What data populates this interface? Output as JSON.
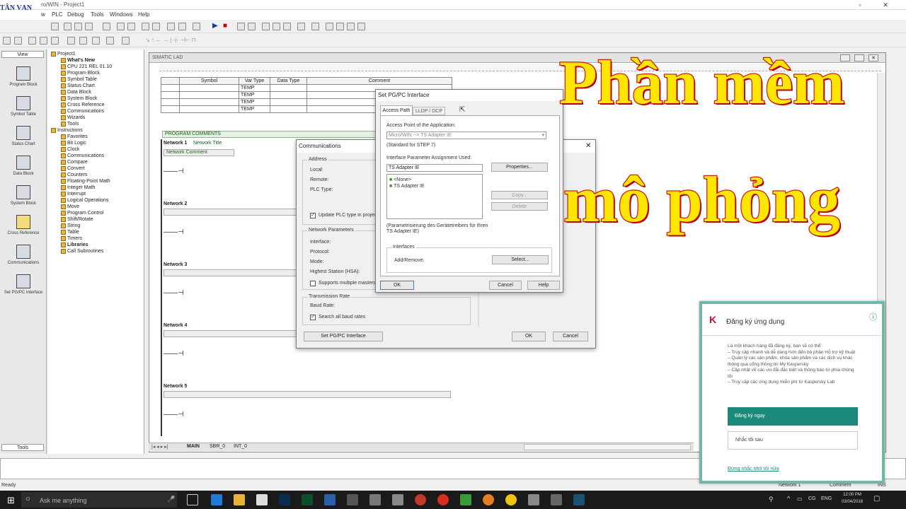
{
  "window": {
    "title": "ro/WIN - Project1",
    "logo_text": "TÂN VẠN"
  },
  "menu": [
    "w",
    "PLC",
    "Debug",
    "Tools",
    "Windows",
    "Help"
  ],
  "navbar": {
    "header": "View",
    "items": [
      "Program Block",
      "Symbol Table",
      "Status Chart",
      "Data Block",
      "System Block",
      "Cross Reference",
      "Communications",
      "Set PG/PC Interface"
    ],
    "footer": "Tools"
  },
  "tree": [
    "Project1",
    "What's New",
    "CPU 221 REL 01.10",
    "Program Block",
    "Symbol Table",
    "Status Chart",
    "Data Block",
    "System Block",
    "Cross Reference",
    "Communications",
    "Wizards",
    "Tools",
    "Instructions",
    "Favorites",
    "Bit Logic",
    "Clock",
    "Communications",
    "Compare",
    "Convert",
    "Counters",
    "Floating-Point Math",
    "Integer Math",
    "Interrupt",
    "Logical Operations",
    "Move",
    "Program Control",
    "Shift/Rotate",
    "String",
    "Table",
    "Timers",
    "Libraries",
    "Call Subroutines"
  ],
  "editor": {
    "title": "SIMATIC LAD",
    "var_table": {
      "headers": [
        "Symbol",
        "Var Type",
        "Data Type",
        "Comment"
      ],
      "rows": [
        "TEMP",
        "TEMP",
        "TEMP",
        "TEMP"
      ]
    },
    "program_comments": "PROGRAM COMMENTS",
    "networks": [
      {
        "label": "Network 1",
        "title": "Network Title",
        "comment": "Network Comment"
      },
      {
        "label": "Network 2"
      },
      {
        "label": "Network 3"
      },
      {
        "label": "Network 4"
      },
      {
        "label": "Network 5"
      }
    ],
    "tabs": [
      "MAIN",
      "SBR_0",
      "INT_0"
    ]
  },
  "comm_dialog": {
    "title": "Communications",
    "address_group": "Address",
    "local_label": "Local:",
    "remote_label": "Remote:",
    "plc_type_label": "PLC Type:",
    "update_plc_label": "Update PLC type in project",
    "network_group": "Network Parameters",
    "interface_label": "Interface:",
    "protocol_label": "Protocol:",
    "mode_label": "Mode:",
    "highest_station_label": "Highest Station (HSA):",
    "multiple_masters_label": "Supports multiple masters",
    "transmission_group": "Transmission Rate",
    "baud_rate_label": "Baud Rate:",
    "search_baud_label": "Search all baud rates",
    "setpg_button": "Set PG/PC Interface",
    "ok": "OK",
    "cancel": "Cancel"
  },
  "pgpc_dialog": {
    "title": "Set PG/PC Interface",
    "tab_access": "Access Path",
    "tab_lldp": "LLDP / DCP",
    "access_point_label": "Access Point of the Application:",
    "access_point_value": "Micro/WIN --> TS Adapter IE",
    "standard_label": "(Standard for STEP 7)",
    "interface_param_label": "Interface Parameter Assignment Used:",
    "interface_param_value": "TS Adapter IE",
    "list_items": [
      "<None>",
      "TS Adapter IE"
    ],
    "properties_btn": "Properties...",
    "copy_btn": "Copy...",
    "delete_btn": "Delete",
    "param_desc": "(Parametrisierung des Gerätetreibers für Ihren TS Adapter IE)",
    "interfaces_group": "Interfaces",
    "add_remove_label": "Add/Remove:",
    "select_btn": "Select...",
    "ok": "OK",
    "cancel": "Cancel",
    "help": "Help"
  },
  "overlay": {
    "line1": "Phần mềm",
    "line2": "mô phỏng"
  },
  "kaspersky": {
    "title": "Đăng ký ứng dụng",
    "info_icon": "ⓘ",
    "body": [
      "Là một khách hàng đã đăng ký, bạn sẽ có thể:",
      "– Truy cập nhanh và dễ dàng hơn đến bộ phận Hỗ trợ kỹ thuật",
      "– Quản lý các sản phẩm, khóa sản phẩm và các dịch vụ khác thông qua cổng thông tin My Kaspersky",
      "– Cập nhật về các ưu đãi đặc biệt và thông báo từ phía chúng tôi",
      "– Truy cập các ứng dụng miễn phí từ Kaspersky Lab"
    ],
    "primary_btn": "Đăng ký ngay",
    "secondary_btn": "Nhắc tôi sau",
    "link": "Đừng nhắc nhở tôi nữa",
    "accent": "#1c8a7a"
  },
  "statusbar": {
    "left": "Ready",
    "network": "Network 1",
    "comment": "Comment",
    "ins": "INS"
  },
  "taskbar": {
    "search_placeholder": "Ask me anything",
    "time": "12:00 PM",
    "date": "03/04/2018",
    "lang": "ENG",
    "tray_text": "CG"
  }
}
